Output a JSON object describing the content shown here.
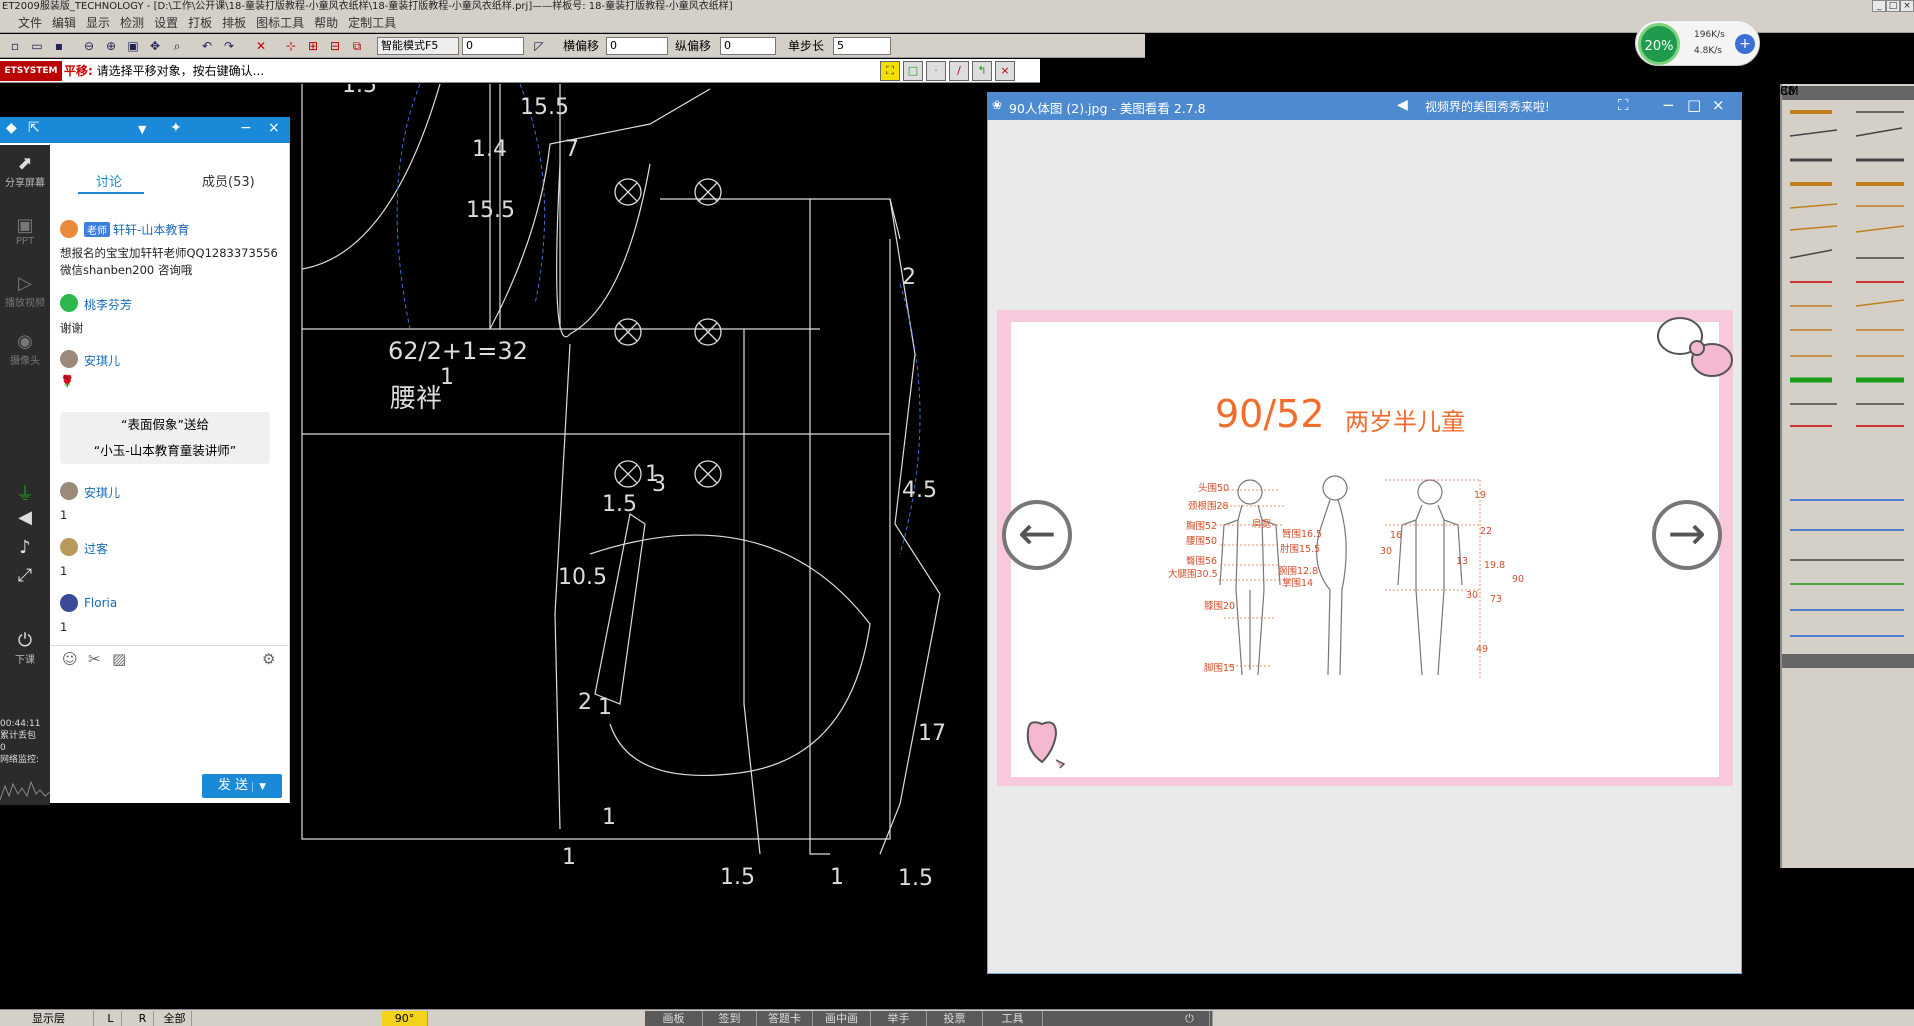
{
  "app": {
    "title": "ET2009服装版_TECHNOLOGY - [D:\\工作\\公开课\\18-童装打版教程-小童风衣纸样\\18-童装打版教程-小童风衣纸样.prj]——样板号: 18-童装打版教程-小童风衣纸样]",
    "window_controls": [
      "_",
      "□",
      "×"
    ]
  },
  "menu": [
    "文件",
    "编辑",
    "显示",
    "检测",
    "设置",
    "打板",
    "排板",
    "图标工具",
    "帮助",
    "定制工具"
  ],
  "toolbar": {
    "mode_select": "智能模式F5",
    "value_input": "0",
    "h_offset_label": "横偏移",
    "h_offset_value": "0",
    "v_offset_label": "纵偏移",
    "v_offset_value": "0",
    "step_label": "单步长",
    "step_value": "5"
  },
  "status": {
    "system_label": "ETSYSTEM",
    "command": "平移:",
    "prompt": "请选择平移对象，按右键确认..."
  },
  "net": {
    "percent": "20%",
    "up_rate": "196K/s",
    "down_rate": "4.8K/s"
  },
  "chat": {
    "tabs": [
      "讨论",
      "成员(53)"
    ],
    "sidebar": [
      "分享屏幕",
      "PPT",
      "播放视频",
      "摄像头",
      "下课"
    ],
    "timer": "00:44:11",
    "lost_label": "累计丢包",
    "lost_value": "0",
    "monitor_label": "网络监控:",
    "messages": [
      {
        "badge": "老师",
        "name": "轩轩-山本教育",
        "text": "想报名的宝宝加轩轩老师QQ1283373556  微信shanben200  咨询哦"
      },
      {
        "name": "桃李芬芳",
        "text": "谢谢"
      },
      {
        "name": "安琪儿",
        "text": "🌹"
      },
      {
        "name": "安琪儿",
        "text": "1"
      },
      {
        "name": "过客",
        "text": "1"
      },
      {
        "name": "Floria",
        "text": "1"
      }
    ],
    "gift_line1": "“表面假象”送给",
    "gift_line2": "“小玉-山本教育童装讲师”",
    "send": "发 送"
  },
  "cad": {
    "labels": [
      "1.5",
      "15.5",
      "1.4",
      "15.5",
      "7",
      "2",
      "62/2+1=32",
      "腰袢",
      "1",
      "1",
      "4.5",
      "3",
      "1.5",
      "10.5",
      "2",
      "1",
      "17",
      "1",
      "1",
      "1.5",
      "1",
      "1.5"
    ]
  },
  "viewer": {
    "title": "90人体图 (2).jpg - 美图看看 2.7.8",
    "ad": "视频界的美图秀秀来啦!",
    "photo_title": "90/52",
    "photo_subtitle": "两岁半儿童",
    "measure_labels": [
      "头围50",
      "颈根围28",
      "胸围52",
      "腰围50",
      "臀围56",
      "大腿围30.5",
      "膝围20",
      "脚围15",
      "肩宽",
      "臂围16.5",
      "肘围15.5",
      "腕围12.8",
      "掌围14",
      "19",
      "16",
      "22",
      "30",
      "13",
      "19.8",
      "90",
      "73",
      "30",
      "49"
    ]
  },
  "bottom": {
    "items": [
      "显示层",
      "L",
      "R",
      "全部",
      "90°",
      "画板",
      "签到",
      "答题卡",
      "画中画",
      "举手",
      "投票",
      "工具"
    ]
  }
}
